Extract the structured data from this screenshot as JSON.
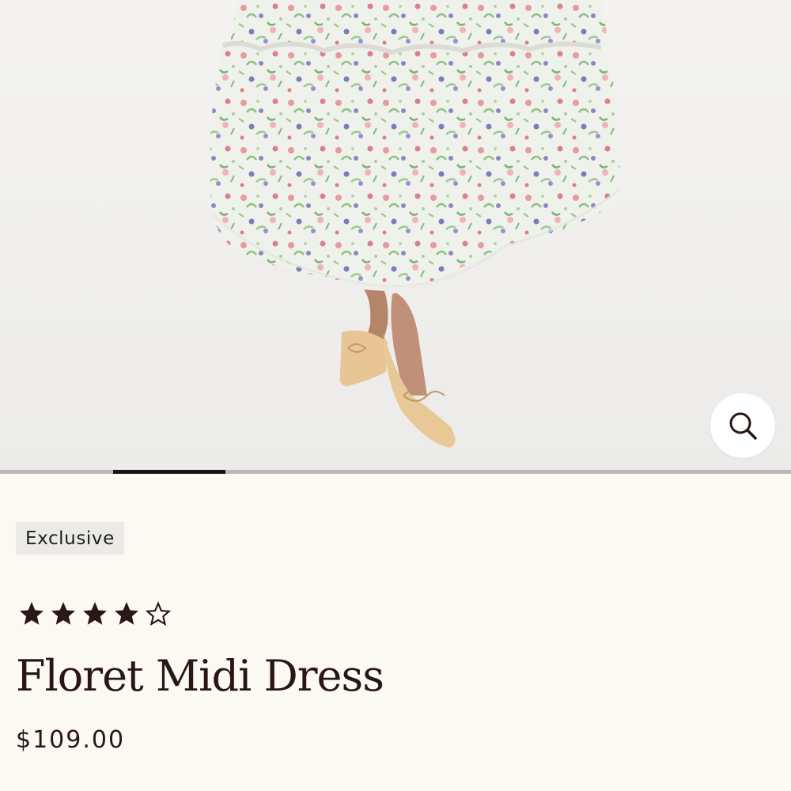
{
  "product": {
    "badge": "Exclusive",
    "rating": 4,
    "rating_max": 5,
    "name": "Floret Midi Dress",
    "price": "$109.00"
  },
  "gallery": {
    "image_index": 2,
    "image_count": 7,
    "zoom_icon": "search-icon"
  },
  "colors": {
    "page_background": "#fcf9f3",
    "text": "#2a1714",
    "badge_background": "#eceae6",
    "progress_active": "#141414",
    "progress_track": "#bdbab6"
  }
}
